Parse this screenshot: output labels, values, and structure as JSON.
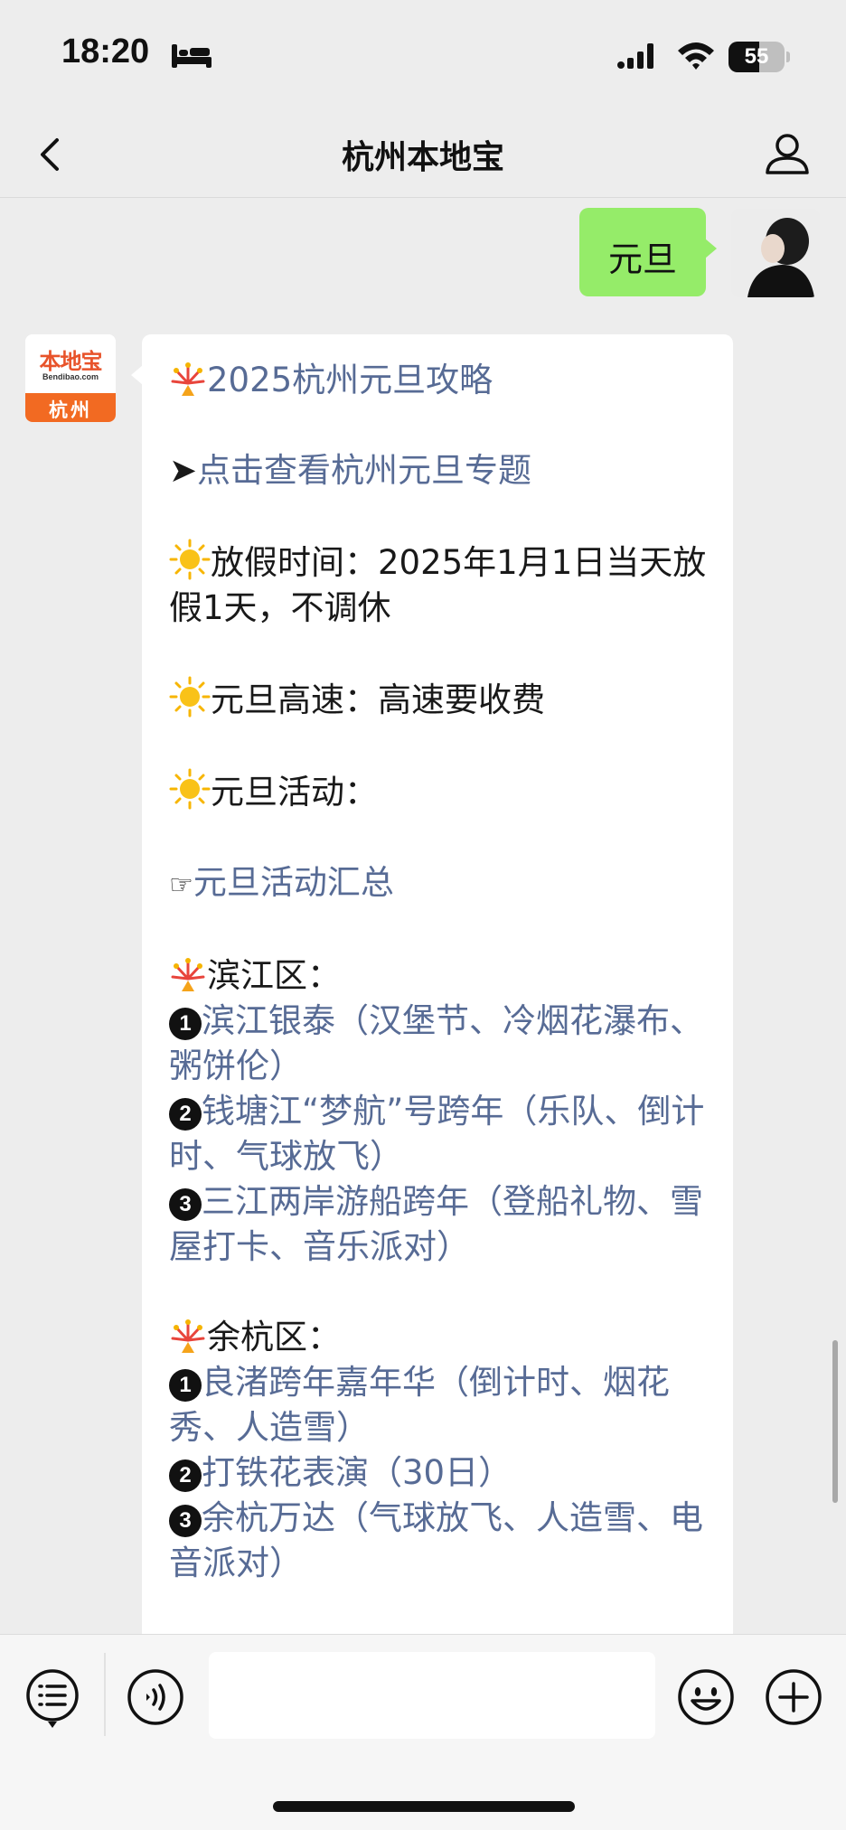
{
  "status_bar": {
    "time": "18:20",
    "battery_level": "55"
  },
  "nav": {
    "title": "杭州本地宝"
  },
  "chat": {
    "outgoing": {
      "text": "元旦"
    },
    "bot_avatar": {
      "brand": "本地宝",
      "url": "Bendibao.com",
      "city": "杭州"
    },
    "incoming": {
      "title": "2025杭州元旦攻略",
      "topic_arrow": "➤",
      "topic_link": "点击查看杭州元旦专题",
      "holiday_label": "放假时间：2025年1月1日当天放假1天，不调休",
      "highway_label": "元旦高速：高速要收费",
      "activities_label": "元旦活动：",
      "activities_pointer": "☞",
      "activities_link": "元旦活动汇总",
      "districts": [
        {
          "name": "滨江区：",
          "items": [
            {
              "num": "1",
              "text": "滨江银泰（汉堡节、冷烟花瀑布、粥饼伦）"
            },
            {
              "num": "2",
              "text": "钱塘江“梦航”号跨年（乐队、倒计时、气球放飞）"
            },
            {
              "num": "3",
              "text": "三江两岸游船跨年（登船礼物、雪屋打卡、音乐派对）"
            }
          ]
        },
        {
          "name": "余杭区：",
          "items": [
            {
              "num": "1",
              "text": "良渚跨年嘉年华（倒计时、烟花秀、人造雪）"
            },
            {
              "num": "2",
              "text": "打铁花表演（30日）"
            },
            {
              "num": "3",
              "text": "余杭万达（气球放飞、人造雪、电音派对）"
            }
          ]
        }
      ]
    }
  },
  "icons": {
    "back": "chevron-left-icon",
    "profile": "person-icon",
    "menu": "list-menu-icon",
    "voice": "voice-icon",
    "emoji": "smiley-icon",
    "plus": "plus-icon",
    "firework": "firework-icon",
    "sun": "sun-icon"
  },
  "colors": {
    "bubble_out": "#95ec69",
    "link": "#576b95",
    "background": "#ededed",
    "brand_orange": "#f26a22"
  }
}
